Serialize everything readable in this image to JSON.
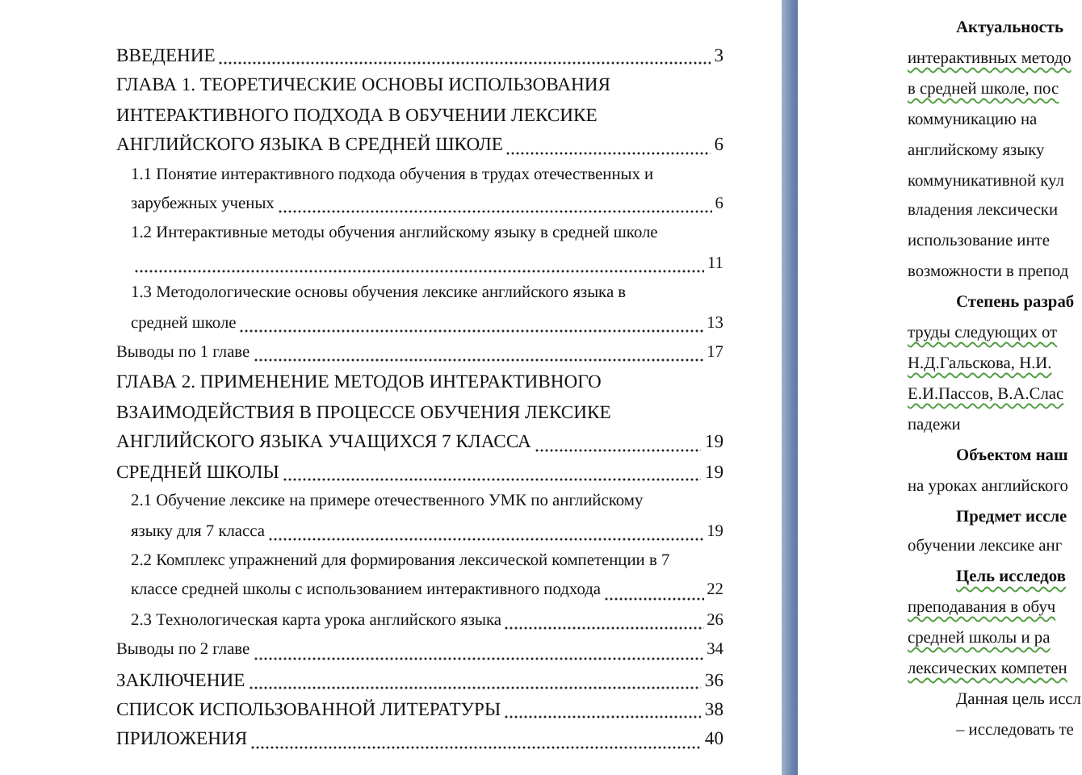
{
  "toc": [
    {
      "lines": [
        "ВВЕДЕНИЕ"
      ],
      "page": "3"
    },
    {
      "lines": [
        "ГЛАВА 1. ТЕОРЕТИЧЕСКИЕ ОСНОВЫ ИСПОЛЬЗОВАНИЯ",
        "ИНТЕРАКТИВНОГО ПОДХОДА В ОБУЧЕНИИ ЛЕКСИКЕ",
        "АНГЛИЙСКОГО ЯЗЫКА В СРЕДНЕЙ ШКОЛЕ"
      ],
      "page": "6",
      "children": [
        {
          "lines": [
            "1.1 Понятие интерактивного подхода обучения в трудах отечественных и",
            "зарубежных ученых"
          ],
          "page": "6"
        },
        {
          "lines": [
            "1.2 Интерактивные методы обучения английскому языку в средней школе"
          ],
          "page": "11",
          "leader_wrap": true
        },
        {
          "lines": [
            "1.3 Методологические основы обучения лексике английского языка в",
            "средней школе"
          ],
          "page": "13"
        }
      ]
    },
    {
      "lines": [
        "Выводы по 1 главе"
      ],
      "page": "17",
      "kind": "small"
    },
    {
      "lines": [
        "ГЛАВА 2. ПРИМЕНЕНИЕ МЕТОДОВ ИНТЕРАКТИВНОГО",
        "ВЗАИМОДЕЙСТВИЯ В ПРОЦЕССЕ ОБУЧЕНИЯ ЛЕКСИКЕ",
        "АНГЛИЙСКОГО ЯЗЫКА УЧАЩИХСЯ 7 КЛАССА"
      ],
      "page": "19"
    },
    {
      "lines": [
        "СРЕДНЕЙ ШКОЛЫ"
      ],
      "page": "19",
      "children": [
        {
          "lines": [
            "2.1 Обучение лексике на примере отечественного УМК по английскому",
            "языку для 7 класса"
          ],
          "page": "19"
        },
        {
          "lines": [
            "2.2 Комплекс упражнений для формирования лексической компетенции в 7",
            "классе средней школы с использованием интерактивного подхода"
          ],
          "page": "22"
        },
        {
          "lines": [
            "2.3 Технологическая карта урока английского языка"
          ],
          "page": "26"
        }
      ]
    },
    {
      "lines": [
        "Выводы по 2 главе"
      ],
      "page": "34",
      "kind": "small"
    },
    {
      "lines": [
        "ЗАКЛЮЧЕНИЕ"
      ],
      "page": "36"
    },
    {
      "lines": [
        "СПИСОК ИСПОЛЬЗОВАННОЙ ЛИТЕРАТУРЫ"
      ],
      "page": "38"
    },
    {
      "lines": [
        "ПРИЛОЖЕНИЯ"
      ],
      "page": "40"
    }
  ],
  "right_page": [
    {
      "text": "Актуальность",
      "kind": "lead",
      "spell_mark": false
    },
    {
      "text": "интерактивных методо",
      "kind": "text",
      "spell_mark": true
    },
    {
      "text": "в средней школе, пос",
      "kind": "text",
      "spell_mark": true
    },
    {
      "text": "коммуникацию на",
      "kind": "text",
      "spell_mark": false
    },
    {
      "text": "английскому языку",
      "kind": "text",
      "spell_mark": false
    },
    {
      "text": "коммуникативной кул",
      "kind": "text",
      "spell_mark": false
    },
    {
      "text": "владения лексически",
      "kind": "text",
      "spell_mark": false
    },
    {
      "text": "использование инте",
      "kind": "text",
      "spell_mark": false
    },
    {
      "text": "возможности в препод",
      "kind": "text",
      "spell_mark": false
    },
    {
      "text": "Степень разраб",
      "kind": "lead",
      "spell_mark": false
    },
    {
      "text": "труды следующих от",
      "kind": "text",
      "spell_mark": true
    },
    {
      "text": "Н.Д.Гальскова, Н.И.",
      "kind": "text",
      "spell_mark": true
    },
    {
      "text": "Е.И.Пассов, В.А.Слас",
      "kind": "text",
      "spell_mark": true
    },
    {
      "text": "падежи",
      "kind": "text",
      "spell_mark": false
    },
    {
      "text": "Объектом наш",
      "kind": "lead",
      "spell_mark": false
    },
    {
      "text": "на уроках английского",
      "kind": "text",
      "spell_mark": false
    },
    {
      "text": "Предмет иссле",
      "kind": "lead",
      "spell_mark": false
    },
    {
      "text": "обучении лексике анг",
      "kind": "text",
      "spell_mark": false
    },
    {
      "text": "Цель исследов",
      "kind": "lead",
      "spell_mark": true
    },
    {
      "text": "преподавания в обуч",
      "kind": "text",
      "spell_mark": true
    },
    {
      "text": "средней школы и ра",
      "kind": "text",
      "spell_mark": true
    },
    {
      "text": "лексических компетен",
      "kind": "text",
      "spell_mark": true
    },
    {
      "text": "Данная цель иссл",
      "kind": "paragraph",
      "spell_mark": false
    },
    {
      "text": "– исследовать те",
      "kind": "list_item",
      "spell_mark": false
    }
  ]
}
